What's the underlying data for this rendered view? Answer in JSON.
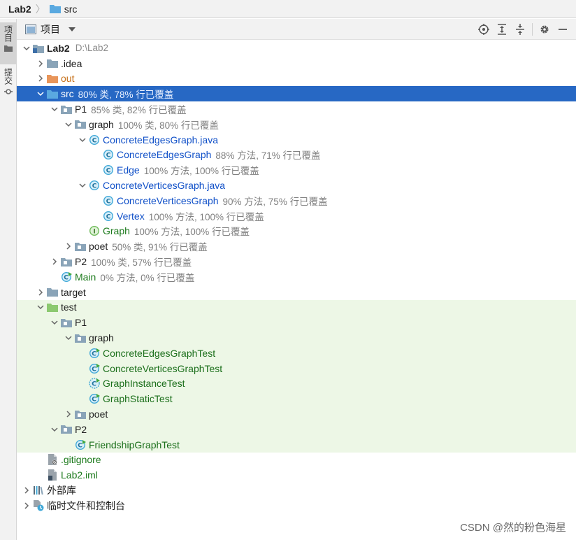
{
  "breadcrumb": {
    "root": "Lab2",
    "folder": "src"
  },
  "side_strip": {
    "project_tab": "项目",
    "commit_tab": "提交"
  },
  "panel": {
    "view_label": "项目"
  },
  "tree": {
    "root": {
      "label": "Lab2",
      "path": "D:\\Lab2"
    },
    "idea": {
      "label": ".idea"
    },
    "out": {
      "label": "out"
    },
    "src": {
      "label": "src",
      "stat": "80% 类, 78% 行已覆盖"
    },
    "p1": {
      "label": "P1",
      "stat": "85% 类, 82% 行已覆盖"
    },
    "graph": {
      "label": "graph",
      "stat": "100% 类, 80% 行已覆盖"
    },
    "edges_file": {
      "label": "ConcreteEdgesGraph.java"
    },
    "edges_class": {
      "label": "ConcreteEdgesGraph",
      "stat": "88% 方法, 71% 行已覆盖"
    },
    "edge_class": {
      "label": "Edge",
      "stat": "100% 方法, 100% 行已覆盖"
    },
    "vertices_file": {
      "label": "ConcreteVerticesGraph.java"
    },
    "vertices_class": {
      "label": "ConcreteVerticesGraph",
      "stat": "90% 方法, 75% 行已覆盖"
    },
    "vertex_class": {
      "label": "Vertex",
      "stat": "100% 方法, 100% 行已覆盖"
    },
    "graph_iface": {
      "label": "Graph",
      "stat": "100% 方法, 100% 行已覆盖"
    },
    "poet": {
      "label": "poet",
      "stat": "50% 类, 91% 行已覆盖"
    },
    "p2": {
      "label": "P2",
      "stat": "100% 类, 57% 行已覆盖"
    },
    "main": {
      "label": "Main",
      "stat": "0% 方法, 0% 行已覆盖"
    },
    "target": {
      "label": "target"
    },
    "test": {
      "label": "test"
    },
    "test_p1": {
      "label": "P1"
    },
    "test_graph": {
      "label": "graph"
    },
    "t_edges": {
      "label": "ConcreteEdgesGraphTest"
    },
    "t_vertices": {
      "label": "ConcreteVerticesGraphTest"
    },
    "t_instance": {
      "label": "GraphInstanceTest"
    },
    "t_static": {
      "label": "GraphStaticTest"
    },
    "test_poet": {
      "label": "poet"
    },
    "test_p2": {
      "label": "P2"
    },
    "t_friendship": {
      "label": "FriendshipGraphTest"
    },
    "gitignore": {
      "label": ".gitignore"
    },
    "iml": {
      "label": "Lab2.iml"
    },
    "ext_libs": {
      "label": "外部库"
    },
    "scratches": {
      "label": "临时文件和控制台"
    }
  },
  "watermark": "CSDN @然的粉色海星",
  "colors": {
    "selection": "#2768c4",
    "test_bg": "#edf7e6",
    "folder": "#8aa4b8",
    "excluded_folder": "#e8955a",
    "src_folder": "#5aa9e0",
    "test_folder": "#8cc970",
    "class_icon": "#3fa8d8",
    "interface_icon": "#6fbb5a"
  }
}
